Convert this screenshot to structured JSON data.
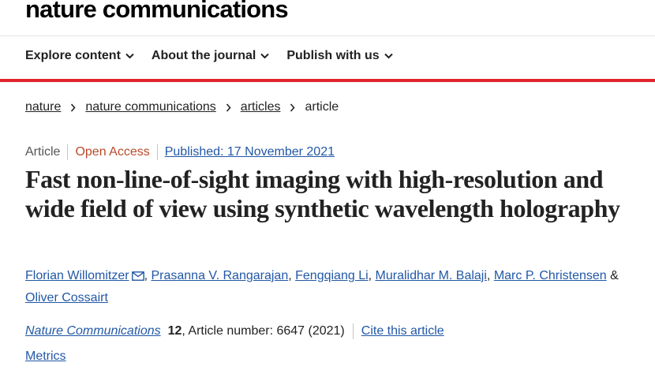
{
  "brand": {
    "name": "nature communications"
  },
  "nav": {
    "items": [
      {
        "label": "Explore content"
      },
      {
        "label": "About the journal"
      },
      {
        "label": "Publish with us"
      }
    ]
  },
  "breadcrumb": {
    "items": [
      "nature",
      "nature communications",
      "articles"
    ],
    "current": "article"
  },
  "meta": {
    "type": "Article",
    "access": "Open Access",
    "published": "Published: 17 November 2021"
  },
  "title": "Fast non-line-of-sight imaging with high-resolution and wide field of view using synthetic wavelength holography",
  "authors": [
    "Florian Willomitzer",
    "Prasanna V. Rangarajan",
    "Fengqiang Li",
    "Muralidhar M. Balaji",
    "Marc P. Christensen",
    "Oliver Cossairt"
  ],
  "citation": {
    "journal": "Nature Communications",
    "volume": "12",
    "article_number": ", Article number: 6647 (2021)",
    "cite_link": "Cite this article"
  },
  "metrics": "Metrics",
  "colors": {
    "accent_red": "#e0232d",
    "link_blue": "#2258a6",
    "open_access": "#b94a2a"
  },
  "icons": {
    "nav_chevron": "chevron-down-icon",
    "breadcrumb_sep": "chevron-right-icon",
    "corresponding_author": "mail-icon"
  }
}
